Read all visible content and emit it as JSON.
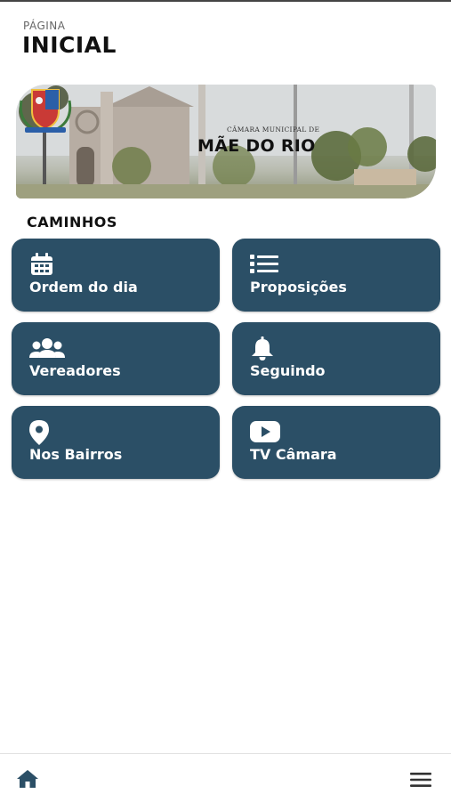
{
  "header": {
    "kicker": "PÁGINA",
    "title": "INICIAL"
  },
  "banner": {
    "subtitle": "CÂMARA MUNICIPAL DE",
    "name": "MÃE DO RIO"
  },
  "section": {
    "title": "CAMINHOS"
  },
  "tiles": [
    {
      "label": "Ordem do dia",
      "icon": "calendar-icon"
    },
    {
      "label": "Proposições",
      "icon": "list-icon"
    },
    {
      "label": "Vereadores",
      "icon": "users-icon"
    },
    {
      "label": "Seguindo",
      "icon": "bell-icon"
    },
    {
      "label": "Nos Bairros",
      "icon": "map-pin-icon"
    },
    {
      "label": "TV Câmara",
      "icon": "youtube-icon"
    }
  ],
  "bottom_nav": {
    "home_icon": "home-icon",
    "menu_icon": "hamburger-menu-icon"
  },
  "colors": {
    "tile": "#2b4f66",
    "nav_icon": "#2b4f66"
  }
}
